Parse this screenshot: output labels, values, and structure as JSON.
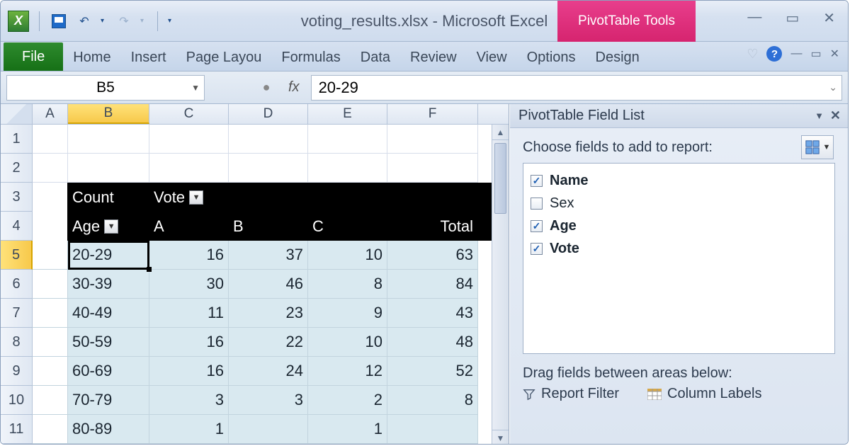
{
  "title": "voting_results.xlsx - Microsoft Excel",
  "pivot_tools_label": "PivotTable Tools",
  "tabs": {
    "file": "File",
    "home": "Home",
    "insert": "Insert",
    "page": "Page Layou",
    "formulas": "Formulas",
    "data": "Data",
    "review": "Review",
    "view": "View",
    "options": "Options",
    "design": "Design"
  },
  "name_box": "B5",
  "formula_value": "20-29",
  "columns": [
    "A",
    "B",
    "C",
    "D",
    "E",
    "F"
  ],
  "row_numbers": [
    "1",
    "2",
    "3",
    "4",
    "5",
    "6",
    "7",
    "8",
    "9",
    "10",
    "11"
  ],
  "pivot": {
    "count_label": "Count",
    "vote_label": "Vote",
    "age_label": "Age",
    "col_headers": [
      "A",
      "B",
      "C",
      "Total"
    ],
    "rows": [
      {
        "age": "20-29",
        "A": "16",
        "B": "37",
        "C": "10",
        "T": "63"
      },
      {
        "age": "30-39",
        "A": "30",
        "B": "46",
        "C": "8",
        "T": "84"
      },
      {
        "age": "40-49",
        "A": "11",
        "B": "23",
        "C": "9",
        "T": "43"
      },
      {
        "age": "50-59",
        "A": "16",
        "B": "22",
        "C": "10",
        "T": "48"
      },
      {
        "age": "60-69",
        "A": "16",
        "B": "24",
        "C": "12",
        "T": "52"
      },
      {
        "age": "70-79",
        "A": "3",
        "B": "3",
        "C": "2",
        "T": "8"
      },
      {
        "age": "80-89",
        "A": "1",
        "B": "",
        "C": "1",
        "T": ""
      }
    ]
  },
  "pane": {
    "title": "PivotTable Field List",
    "choose": "Choose fields to add to report:",
    "fields": [
      {
        "label": "Name",
        "checked": true,
        "bold": true
      },
      {
        "label": "Sex",
        "checked": false,
        "bold": false
      },
      {
        "label": "Age",
        "checked": true,
        "bold": true
      },
      {
        "label": "Vote",
        "checked": true,
        "bold": true
      }
    ],
    "drag": "Drag fields between areas below:",
    "report_filter": "Report Filter",
    "column_labels": "Column Labels"
  }
}
